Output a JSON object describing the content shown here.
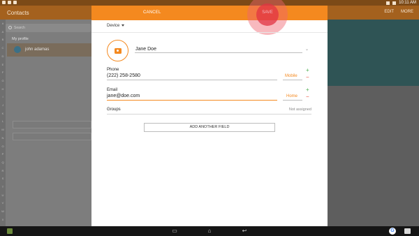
{
  "status_bar": {
    "time": "10:11 AM"
  },
  "background_app": {
    "title": "Contacts",
    "actions": [
      "EDIT",
      "MORE"
    ],
    "search_placeholder": "Search",
    "section_label": "My profile",
    "profile_name": "john adamas",
    "index_letters": [
      "#",
      "A",
      "B",
      "C",
      "D",
      "E",
      "F",
      "G",
      "H",
      "I",
      "J",
      "K",
      "L",
      "M",
      "N",
      "O",
      "P",
      "Q",
      "R",
      "S",
      "T",
      "U",
      "V",
      "W",
      "X",
      "Y",
      "Z"
    ]
  },
  "dialog": {
    "cancel_label": "CANCEL",
    "save_label": "SAVE",
    "storage": "Device",
    "name": "Jane Doe",
    "phone": {
      "label": "Phone",
      "value": "(222) 258-2580",
      "type": "Mobile"
    },
    "email": {
      "label": "Email",
      "value": "jane@doe.com",
      "type": "Home"
    },
    "groups": {
      "label": "Groups",
      "value": "Not assigned"
    },
    "add_field_label": "ADD ANOTHER FIELD"
  },
  "icons": {
    "plus": "+",
    "minus": "−",
    "chevron": "⌄",
    "nav_recents": "▭",
    "nav_home": "⌂",
    "nav_back": "↩",
    "google": "G"
  },
  "colors": {
    "accent": "#f4891f",
    "save_ripple": "#e23442",
    "add": "#4caf50",
    "remove": "#e74c3c"
  }
}
